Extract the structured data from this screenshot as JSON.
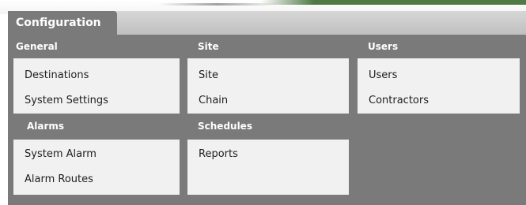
{
  "tabs": {
    "active_label": "Configuration"
  },
  "sections": {
    "general": {
      "title": "General",
      "items": [
        "Destinations",
        "System Settings"
      ]
    },
    "site": {
      "title": "Site",
      "items": [
        "Site",
        "Chain"
      ]
    },
    "users": {
      "title": "Users",
      "items": [
        "Users",
        "Contractors"
      ]
    },
    "alarms": {
      "title": "Alarms",
      "items": [
        "System Alarm",
        "Alarm Routes"
      ]
    },
    "schedules": {
      "title": "Schedules",
      "items": [
        "Reports"
      ]
    }
  },
  "colors": {
    "panel": "#7a7a7a",
    "card": "#f2f1f1",
    "tab_bar": "#c8c8c8",
    "accent_green": "#4f7a43"
  }
}
